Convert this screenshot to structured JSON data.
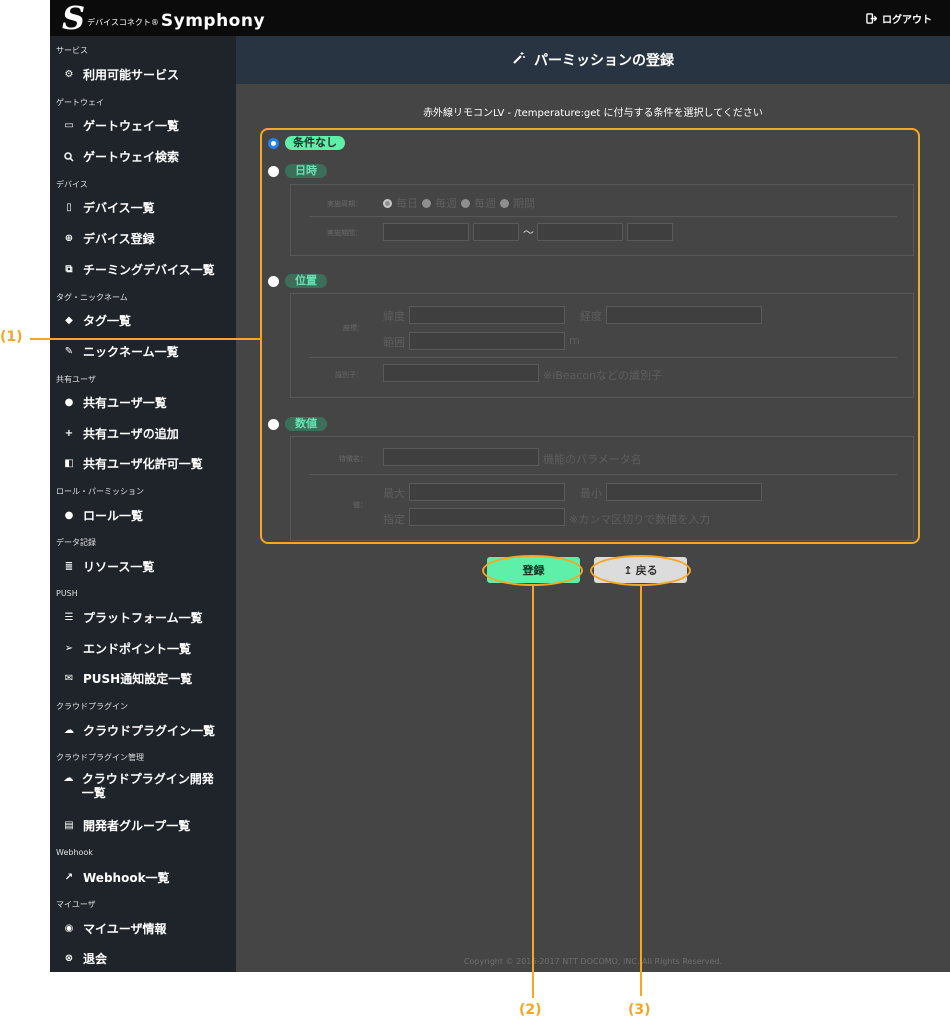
{
  "brand": {
    "logo_letter": "S",
    "logo_sub": "デバイスコネクト®",
    "logo_name": "Symphony"
  },
  "topbar": {
    "logout_label": "ログアウト"
  },
  "sidebar": {
    "sections": [
      {
        "title": "サービス",
        "items": [
          {
            "label": "利用可能サービス",
            "icon": "gears-icon"
          }
        ]
      },
      {
        "title": "ゲートウェイ",
        "items": [
          {
            "label": "ゲートウェイ一覧",
            "icon": "gateway-icon"
          },
          {
            "label": "ゲートウェイ検索",
            "icon": "search-icon"
          }
        ]
      },
      {
        "title": "デバイス",
        "items": [
          {
            "label": "デバイス一覧",
            "icon": "device-icon"
          },
          {
            "label": "デバイス登録",
            "icon": "plus-circle-icon"
          },
          {
            "label": "チーミングデバイス一覧",
            "icon": "clone-icon"
          }
        ]
      },
      {
        "title": "タグ・ニックネーム",
        "items": [
          {
            "label": "タグ一覧",
            "icon": "tags-icon"
          },
          {
            "label": "ニックネーム一覧",
            "icon": "pencil-icon"
          }
        ]
      },
      {
        "title": "共有ユーザ",
        "items": [
          {
            "label": "共有ユーザ一覧",
            "icon": "user-icon"
          },
          {
            "label": "共有ユーザの追加",
            "icon": "user-plus-icon"
          },
          {
            "label": "共有ユーザ化許可一覧",
            "icon": "unlock-icon"
          }
        ]
      },
      {
        "title": "ロール・パーミッション",
        "items": [
          {
            "label": "ロール一覧",
            "icon": "users-icon"
          }
        ]
      },
      {
        "title": "データ記録",
        "items": [
          {
            "label": "リソース一覧",
            "icon": "database-icon"
          }
        ]
      },
      {
        "title": "PUSH",
        "items": [
          {
            "label": "プラットフォーム一覧",
            "icon": "server-icon"
          },
          {
            "label": "エンドポイント一覧",
            "icon": "paper-plane-icon"
          },
          {
            "label": "PUSH通知設定一覧",
            "icon": "envelope-icon"
          }
        ]
      },
      {
        "title": "クラウドプラグイン",
        "items": [
          {
            "label": "クラウドプラグイン一覧",
            "icon": "cloud-icon"
          }
        ]
      },
      {
        "title": "クラウドプラグイン管理",
        "items": [
          {
            "label": "クラウドプラグイン開発一覧",
            "icon": "cloud-upload-icon"
          },
          {
            "label": "開発者グループ一覧",
            "icon": "id-card-icon"
          }
        ]
      },
      {
        "title": "Webhook",
        "items": [
          {
            "label": "Webhook一覧",
            "icon": "external-link-icon"
          }
        ]
      },
      {
        "title": "マイユーザ",
        "items": [
          {
            "label": "マイユーザ情報",
            "icon": "user-circle-icon"
          },
          {
            "label": "退会",
            "icon": "times-circle-icon"
          }
        ]
      }
    ]
  },
  "page": {
    "title": "パーミッションの登録",
    "subtitle": "赤外線リモコンLV - /temperature:get に付与する条件を選択してください"
  },
  "form": {
    "opt_none": "条件なし",
    "opt_datetime": "日時",
    "dt_period_label": "実施周期：",
    "dt_daily": "毎日",
    "dt_weekly": "毎週",
    "dt_monthly": "毎週",
    "dt_term": "期間",
    "dt_time_label": "実施期間：",
    "dt_tilde": "〜",
    "opt_location": "位置",
    "loc_coord_label": "座標：",
    "loc_lat": "緯度",
    "loc_lng": "経度",
    "loc_range": "範囲",
    "loc_unit": "m",
    "loc_id_label": "識別子：",
    "loc_id_hint": "※iBeaconなどの識別子",
    "opt_number": "数値",
    "num_param_label": "特徴名：",
    "num_param_hint": "機能のパラメータ名",
    "num_value_label": "値：",
    "num_max": "最大",
    "num_min": "最小",
    "num_spec": "指定",
    "num_spec_hint": "※カンマ区切りで数値を入力"
  },
  "buttons": {
    "save": "登録",
    "back": "戻る"
  },
  "callouts": [
    "(1)",
    "(2)",
    "(3)"
  ],
  "footer": {
    "copyright": "Copyright © 2016-2017 NTT DOCOMO, INC. All Rights Reserved."
  },
  "colors": {
    "accent": "#5ef0a8",
    "highlight": "#f5a623",
    "sidebar": "#1f242b",
    "header": "#283441"
  }
}
